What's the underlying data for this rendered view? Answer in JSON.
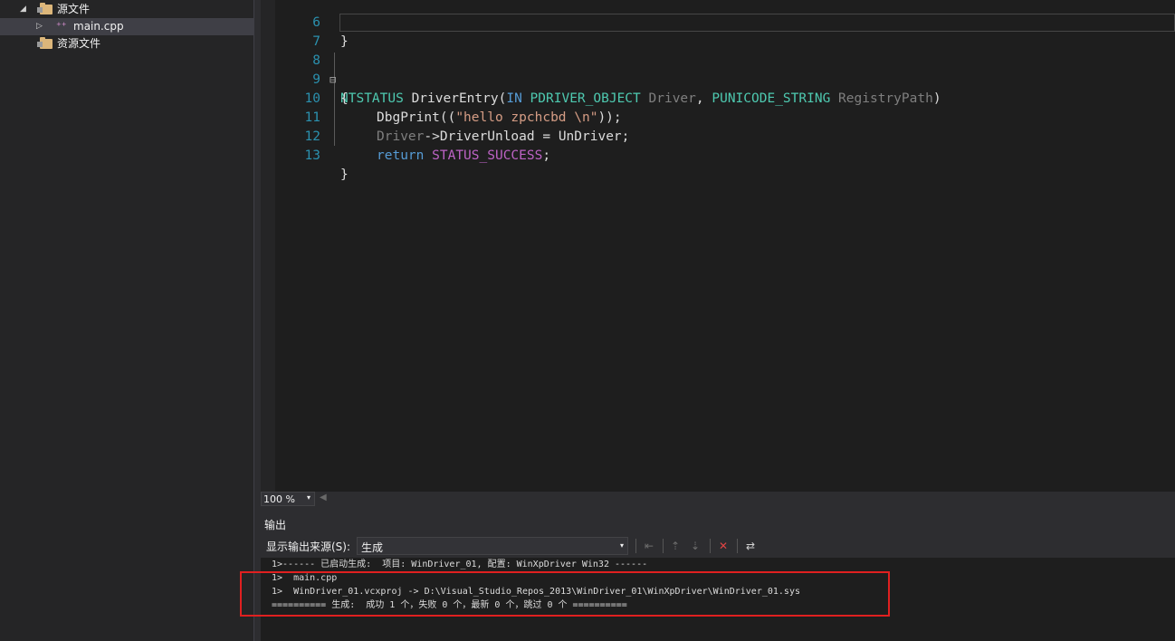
{
  "solution_explorer": {
    "items": [
      {
        "label": "源文件",
        "expander": "◢"
      },
      {
        "label": "main.cpp",
        "expander": "▷",
        "file_icon": "⁺⁺"
      },
      {
        "label": "资源文件"
      }
    ]
  },
  "editor": {
    "lines": [
      {
        "number": "6"
      },
      {
        "number": "7"
      },
      {
        "number": "8",
        "fold": "⊟",
        "code": {
          "type": "NTSTATUS",
          "func": "DriverEntry",
          "open": "(",
          "kw_in": "IN",
          "t1": "PDRIVER_OBJECT",
          "p1": "Driver",
          "comma": ",",
          "t2": "PUNICODE_STRING",
          "p2": "RegistryPath",
          "close": ")"
        }
      },
      {
        "number": "9",
        "code": {
          "text": "{"
        }
      },
      {
        "number": "10",
        "code": {
          "fn": "DbgPrint",
          "pre": "((",
          "str": "\"hello zpchcbd \\n\"",
          "post": "));"
        }
      },
      {
        "number": "11",
        "code": {
          "obj": "Driver",
          "arrow": "->",
          "member": "DriverUnload",
          "eq": " = ",
          "val": "UnDriver;"
        }
      },
      {
        "number": "12",
        "code": {
          "kw": "return",
          "mac": "STATUS_SUCCESS",
          "semi": ";"
        }
      },
      {
        "number": "13",
        "code": {
          "text": "}"
        }
      }
    ],
    "line6_code": "}"
  },
  "zoom": {
    "value": "100 %",
    "arrow": "▾",
    "scroll_left": "◀"
  },
  "output": {
    "title": "输出",
    "source_label": "显示输出来源(S):",
    "source_value": "生成",
    "select_arrow": "▾",
    "lines": [
      "1>------ 已启动生成:  项目: WinDriver_01, 配置: WinXpDriver Win32 ------",
      "1>  main.cpp",
      "1>  WinDriver_01.vcxproj -> D:\\Visual_Studio_Repos_2013\\WinDriver_01\\WinXpDriver\\WinDriver_01.sys",
      "========== 生成:  成功 1 个，失败 0 个，最新 0 个，跳过 0 个 =========="
    ],
    "toolbar_icons": {
      "goto": "⇤",
      "prev": "⇡",
      "next": "⇣",
      "clear": "✕",
      "wrap": "⇄"
    }
  },
  "colors": {
    "highlight": "#e02020"
  }
}
